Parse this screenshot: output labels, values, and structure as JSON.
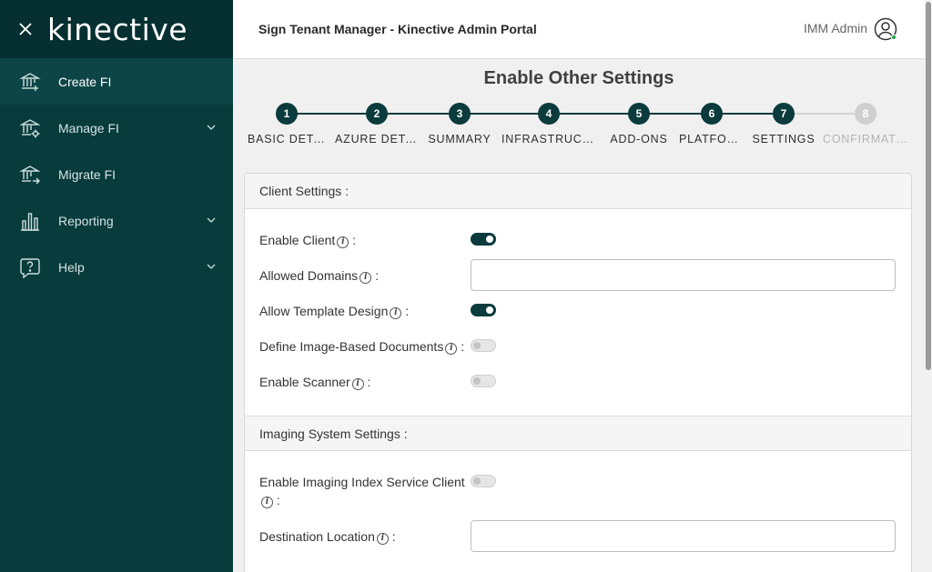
{
  "sidebar": {
    "logo_text": "kinective",
    "items": [
      {
        "label": "Create FI",
        "icon": "bank-add-icon",
        "active": true,
        "has_chevron": false
      },
      {
        "label": "Manage FI",
        "icon": "bank-gear-icon",
        "active": false,
        "has_chevron": true
      },
      {
        "label": "Migrate FI",
        "icon": "bank-arrow-icon",
        "active": false,
        "has_chevron": false
      },
      {
        "label": "Reporting",
        "icon": "bar-chart-icon",
        "active": false,
        "has_chevron": true
      },
      {
        "label": "Help",
        "icon": "help-icon",
        "active": false,
        "has_chevron": true
      }
    ]
  },
  "header": {
    "title": "Sign Tenant Manager - Kinective Admin Portal",
    "user_name": "IMM Admin"
  },
  "main": {
    "page_title": "Enable Other Settings",
    "steps": [
      {
        "number": "1",
        "label": "BASIC DETAILS",
        "state": "complete"
      },
      {
        "number": "2",
        "label": "AZURE DETAILS",
        "state": "complete"
      },
      {
        "number": "3",
        "label": "SUMMARY",
        "state": "complete"
      },
      {
        "number": "4",
        "label": "INFRASTRUCTURE",
        "state": "complete"
      },
      {
        "number": "5",
        "label": "ADD-ONS",
        "state": "complete"
      },
      {
        "number": "6",
        "label": "PLATFORM",
        "state": "complete"
      },
      {
        "number": "7",
        "label": "SETTINGS",
        "state": "current"
      },
      {
        "number": "8",
        "label": "CONFIRMATION",
        "state": "disabled"
      }
    ],
    "client_settings": {
      "header": "Client Settings :",
      "enable_client": {
        "label": "Enable Client",
        "enabled": true
      },
      "allowed_domains": {
        "label": "Allowed Domains",
        "value": ""
      },
      "allow_template_design": {
        "label": "Allow Template Design",
        "enabled": true
      },
      "define_image_based_documents": {
        "label": "Define Image-Based Documents",
        "enabled": false
      },
      "enable_scanner": {
        "label": "Enable Scanner",
        "enabled": false
      }
    },
    "imaging_settings": {
      "header": "Imaging System Settings :",
      "enable_imaging_index_service_client": {
        "label": "Enable Imaging Index Service Client",
        "enabled": false
      },
      "destination_location": {
        "label": "Destination Location",
        "value": ""
      }
    },
    "colon": ":"
  },
  "colors": {
    "sidebar_bg": "#073b3c",
    "accent": "#0b3b3c",
    "disabled": "#cfcfcf",
    "online": "#1e9e4a"
  }
}
